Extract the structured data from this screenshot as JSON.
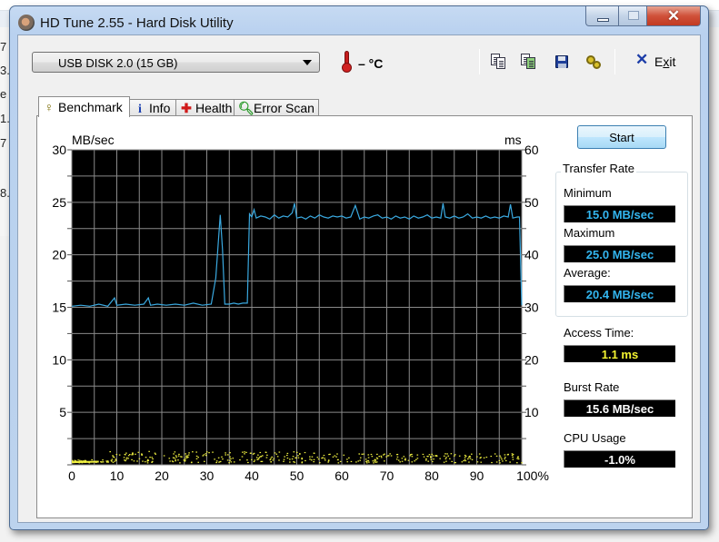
{
  "window": {
    "title": "HD Tune 2.55 - Hard Disk Utility",
    "controls": {
      "minimize": "minimize",
      "maximize": "maximize",
      "close": "close"
    }
  },
  "background_chars": [
    "7",
    "3.",
    "e",
    "1.",
    "7",
    "8."
  ],
  "toolbar": {
    "drive": "USB DISK 2.0 (15 GB)",
    "temperature": "– °C",
    "icons": [
      "copy-text-icon",
      "copy-screenshot-icon",
      "save-icon",
      "options-icon"
    ],
    "exit_label_pre": "E",
    "exit_label_u": "x",
    "exit_label_post": "it"
  },
  "tabs": [
    {
      "label": "Benchmark",
      "icon": "lightbulb-icon",
      "active": true
    },
    {
      "label": "Info",
      "icon": "info-icon",
      "active": false
    },
    {
      "label": "Health",
      "icon": "health-cross-icon",
      "active": false
    },
    {
      "label": "Error Scan",
      "icon": "magnifier-icon",
      "active": false
    }
  ],
  "benchmark": {
    "start_label": "Start",
    "transfer_rate_title": "Transfer Rate",
    "minimum_label": "Minimum",
    "minimum_value": "15.0 MB/sec",
    "maximum_label": "Maximum",
    "maximum_value": "25.0 MB/sec",
    "average_label": "Average:",
    "average_value": "20.4 MB/sec",
    "access_time_label": "Access Time:",
    "access_time_value": "1.1 ms",
    "burst_rate_label": "Burst Rate",
    "burst_rate_value": "15.6 MB/sec",
    "cpu_usage_label": "CPU Usage",
    "cpu_usage_value": "-1.0%"
  },
  "colors": {
    "transfer_line": "#3aa9e0",
    "access_points": "#f0f040",
    "plot_bg": "#000000",
    "grid": "#8a8a8a"
  },
  "chart_data": {
    "type": "line",
    "title": "",
    "ylabel": "MB/sec",
    "y2label": "ms",
    "xlabel": "",
    "ylim": [
      0,
      30
    ],
    "y2lim": [
      0,
      60
    ],
    "xlim": [
      0,
      100
    ],
    "grid": true,
    "y_ticks": [
      "5",
      "10",
      "15",
      "20",
      "25",
      "30"
    ],
    "y2_ticks": [
      "10",
      "20",
      "30",
      "40",
      "50",
      "60"
    ],
    "x_ticks": [
      "0",
      "10",
      "20",
      "30",
      "40",
      "50",
      "60",
      "70",
      "80",
      "90",
      "100%"
    ],
    "series": [
      {
        "name": "Transfer Rate (MB/sec)",
        "x": [
          0,
          2,
          4,
          6,
          8,
          9.5,
          10,
          12,
          14,
          16,
          17,
          17.5,
          19,
          21,
          23,
          25,
          27,
          29,
          31,
          32,
          33,
          33.5,
          34,
          35,
          36,
          37,
          38,
          39,
          39.5,
          40,
          40.5,
          41,
          42,
          43,
          44,
          45,
          46,
          47,
          48,
          49,
          49.5,
          50,
          51,
          52,
          53,
          54,
          55,
          56,
          57,
          58,
          59,
          60,
          61,
          62,
          63,
          64,
          65,
          66,
          67,
          68,
          69,
          70,
          71,
          72,
          73,
          74,
          75,
          76,
          77,
          78,
          79,
          80,
          81,
          82,
          82.5,
          83,
          84,
          85,
          86,
          87,
          88,
          89,
          90,
          91,
          92,
          93,
          94,
          95,
          96,
          97,
          97.5,
          98,
          99,
          99.5,
          100
        ],
        "values": [
          15.1,
          15.2,
          15.1,
          15.3,
          15.1,
          15.9,
          15.2,
          15.3,
          15.2,
          15.3,
          15.9,
          15.2,
          15.3,
          15.2,
          15.3,
          15.2,
          15.4,
          15.2,
          15.3,
          17.8,
          23.8,
          20.5,
          15.3,
          15.3,
          15.4,
          15.3,
          15.4,
          15.4,
          23.9,
          23.6,
          24.3,
          23.5,
          23.7,
          23.6,
          23.4,
          23.8,
          23.5,
          23.7,
          23.6,
          24.0,
          24.9,
          23.5,
          23.6,
          23.4,
          23.7,
          23.5,
          23.8,
          23.6,
          23.5,
          23.7,
          23.6,
          23.7,
          23.5,
          23.6,
          24.7,
          23.4,
          23.6,
          23.5,
          23.7,
          23.8,
          23.5,
          23.6,
          23.4,
          23.7,
          23.5,
          23.6,
          23.4,
          23.7,
          23.5,
          23.6,
          23.8,
          23.5,
          23.6,
          23.5,
          24.9,
          23.6,
          23.5,
          23.7,
          23.5,
          23.6,
          23.9,
          23.5,
          23.6,
          23.5,
          23.7,
          23.5,
          23.6,
          23.5,
          23.7,
          23.6,
          24.8,
          23.5,
          23.6,
          23.6,
          15.2
        ]
      },
      {
        "name": "Access Time (ms)",
        "type": "scatter",
        "x_range": [
          0,
          100
        ],
        "values_range_ms": [
          0.3,
          2.5
        ],
        "note": "dense small yellow points near 1 ms"
      }
    ]
  }
}
